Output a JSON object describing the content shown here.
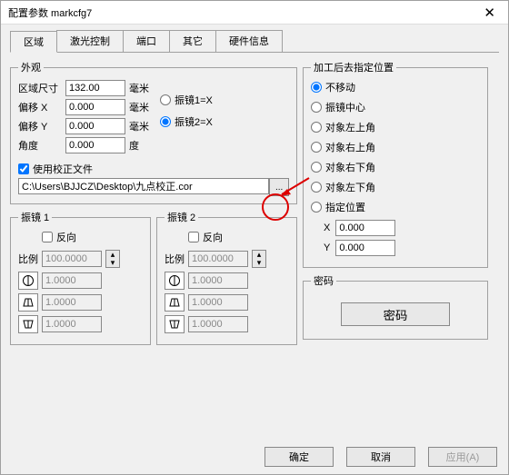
{
  "window": {
    "title": "配置参数 markcfg7"
  },
  "tabs": [
    "区域",
    "激光控制",
    "端口",
    "其它",
    "硬件信息"
  ],
  "appearance": {
    "legend": "外观",
    "size_label": "区域尺寸",
    "size_val": "132.00",
    "size_unit": "毫米",
    "offx_label": "偏移 X",
    "offx_val": "0.000",
    "offx_unit": "毫米",
    "offy_label": "偏移 Y",
    "offy_val": "0.000",
    "offy_unit": "毫米",
    "angle_label": "角度",
    "angle_val": "0.000",
    "angle_unit": "度",
    "mirror1": "振镜1=X",
    "mirror2": "振镜2=X",
    "usefile_label": "使用校正文件",
    "filepath": "C:\\Users\\BJJCZ\\Desktop\\九点校正.cor",
    "browse": "..."
  },
  "galvo1": {
    "legend": "振镜 1",
    "reverse": "反向",
    "ratio_label": "比例",
    "ratio": "100.0000",
    "v1": "1.0000",
    "v2": "1.0000",
    "v3": "1.0000"
  },
  "galvo2": {
    "legend": "振镜 2",
    "reverse": "反向",
    "ratio_label": "比例",
    "ratio": "100.0000",
    "v1": "1.0000",
    "v2": "1.0000",
    "v3": "1.0000"
  },
  "goto": {
    "legend": "加工后去指定位置",
    "opts": [
      "不移动",
      "振镜中心",
      "对象左上角",
      "对象右上角",
      "对象右下角",
      "对象左下角",
      "指定位置"
    ],
    "x_label": "X",
    "x_val": "0.000",
    "y_label": "Y",
    "y_val": "0.000"
  },
  "password": {
    "legend": "密码",
    "btn": "密码"
  },
  "footer": {
    "ok": "确定",
    "cancel": "取消",
    "apply": "应用(A)"
  }
}
